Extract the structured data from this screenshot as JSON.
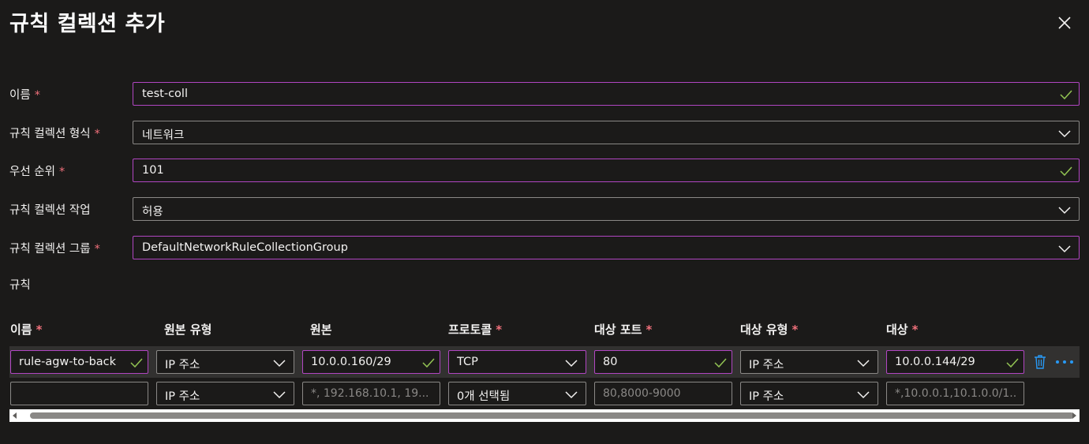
{
  "title": "규칙 컬렉션 추가",
  "required_mark": "*",
  "form": {
    "name": {
      "label": "이름",
      "value": "test-coll"
    },
    "type": {
      "label": "규칙 컬렉션 형식",
      "value": "네트워크"
    },
    "priority": {
      "label": "우선 순위",
      "value": "101"
    },
    "action": {
      "label": "규칙 컬렉션 작업",
      "value": "허용"
    },
    "group": {
      "label": "규칙 컬렉션 그룹",
      "value": "DefaultNetworkRuleCollectionGroup"
    }
  },
  "rules_section_label": "규칙",
  "columns": {
    "name": "이름",
    "source_type": "원본 유형",
    "source": "원본",
    "protocol": "프로토콜",
    "dest_ports": "대상 포트",
    "dest_type": "대상 유형",
    "destination": "대상"
  },
  "rules": [
    {
      "name": "rule-agw-to-back",
      "source_type": "IP 주소",
      "source": "10.0.0.160/29",
      "protocol": "TCP",
      "dest_ports": "80",
      "dest_type": "IP 주소",
      "destination": "10.0.0.144/29"
    }
  ],
  "new_rule": {
    "name": "",
    "source_type": "IP 주소",
    "source_placeholder": "*, 192.168.10.1, 19...",
    "protocol": "0개 선택됨",
    "dest_ports_placeholder": "80,8000-9000",
    "dest_type": "IP 주소",
    "destination_placeholder": "*,10.0.0.1,10.1.0.0/1..."
  },
  "colors": {
    "background": "#1b1a19",
    "focus_border": "#b146c2",
    "valid_check": "#92c353",
    "required": "#f1707b",
    "link_blue": "#2899f5"
  },
  "icons": {
    "close": "close-icon",
    "valid": "check-icon",
    "dropdown": "chevron-down-icon",
    "delete": "trash-icon",
    "more": "more-icon"
  }
}
